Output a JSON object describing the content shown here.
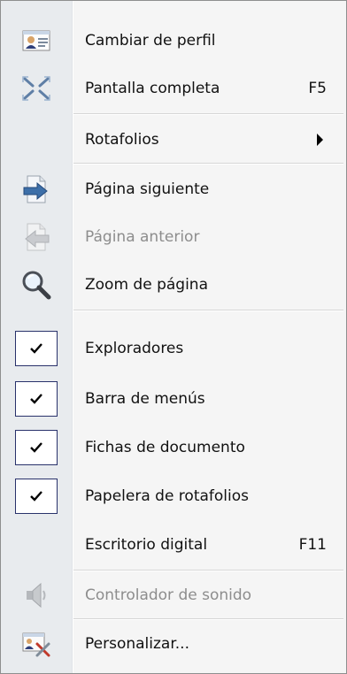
{
  "menu": {
    "items": [
      {
        "label": "Cambiar de perfil",
        "icon": "profile-card-icon",
        "enabled": true
      },
      {
        "label": "Pantalla completa",
        "shortcut": "F5",
        "icon": "fullscreen-icon",
        "enabled": true
      },
      {
        "label": "Rotafolios",
        "icon": "",
        "submenu": true,
        "enabled": true
      },
      {
        "label": "Página siguiente",
        "icon": "next-page-icon",
        "enabled": true
      },
      {
        "label": "Página anterior",
        "icon": "previous-page-icon",
        "enabled": false
      },
      {
        "label": "Zoom de página",
        "icon": "magnifier-icon",
        "enabled": true
      },
      {
        "label": "Exploradores",
        "checked": true,
        "enabled": true
      },
      {
        "label": "Barra de menús",
        "checked": true,
        "enabled": true
      },
      {
        "label": "Fichas de documento",
        "checked": true,
        "enabled": true
      },
      {
        "label": "Papelera de rotafolios",
        "checked": true,
        "enabled": true
      },
      {
        "label": "Escritorio digital",
        "shortcut": "F11",
        "enabled": true
      },
      {
        "label": "Controlador de sonido",
        "icon": "speaker-icon",
        "enabled": false
      },
      {
        "label": "Personalizar...",
        "icon": "customize-icon",
        "enabled": true
      }
    ]
  },
  "colors": {
    "menu_background": "#f5f5f5",
    "gutter": "#e8ebee",
    "text": "#111111",
    "disabled_text": "#8d8d8d",
    "check_border": "#29326b",
    "separator": "#d6d6d6"
  }
}
